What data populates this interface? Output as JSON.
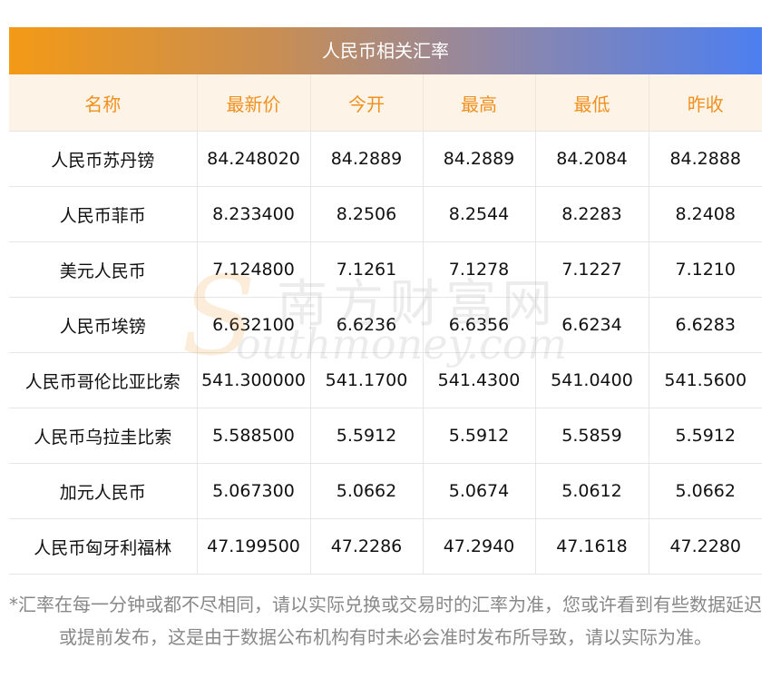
{
  "header": {
    "title": "人民币相关汇率"
  },
  "table": {
    "columns": [
      "名称",
      "最新价",
      "今开",
      "最高",
      "最低",
      "昨收"
    ],
    "rows": [
      [
        "人民币苏丹镑",
        "84.248020",
        "84.2889",
        "84.2889",
        "84.2084",
        "84.2888"
      ],
      [
        "人民币菲币",
        "8.233400",
        "8.2506",
        "8.2544",
        "8.2283",
        "8.2408"
      ],
      [
        "美元人民币",
        "7.124800",
        "7.1261",
        "7.1278",
        "7.1227",
        "7.1210"
      ],
      [
        "人民币埃镑",
        "6.632100",
        "6.6236",
        "6.6356",
        "6.6234",
        "6.6283"
      ],
      [
        "人民币哥伦比亚比索",
        "541.300000",
        "541.1700",
        "541.4300",
        "541.0400",
        "541.5600"
      ],
      [
        "人民币乌拉圭比索",
        "5.588500",
        "5.5912",
        "5.5912",
        "5.5859",
        "5.5912"
      ],
      [
        "加元人民币",
        "5.067300",
        "5.0662",
        "5.0674",
        "5.0612",
        "5.0662"
      ],
      [
        "人民币匈牙利福林",
        "47.199500",
        "47.2286",
        "47.2940",
        "47.1618",
        "47.2280"
      ]
    ]
  },
  "watermark": {
    "cn": "南方财富网",
    "en": "outhmoney.com",
    "s": "S"
  },
  "note": "*汇率在每一分钟或都不尽相同，请以实际兑换或交易时的汇率为准，您或许看到有些数据延迟或提前发布，这是由于数据公布机构有时未必会准时发布所导致，请以实际为准。",
  "colors": {
    "header_start": "#f39a16",
    "header_end": "#4d7ff0",
    "column_header_text": "#f0901e",
    "column_header_bg": "#fdf4e7"
  }
}
